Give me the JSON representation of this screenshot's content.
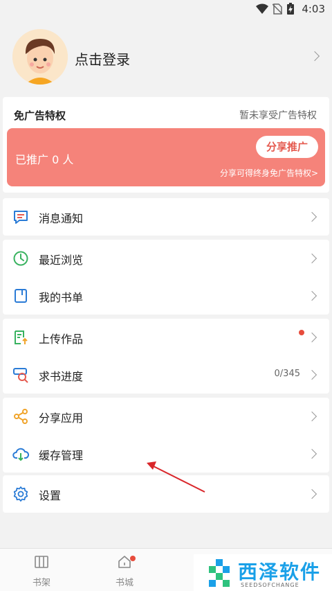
{
  "status": {
    "time": "4:03"
  },
  "profile": {
    "login_label": "点击登录"
  },
  "ad_privilege": {
    "title": "免广告特权",
    "status": "暂未享受广告特权",
    "promoted_text": "已推广 0 人",
    "share_button": "分享推广",
    "share_hint": "分享可得终身免广告特权>"
  },
  "menu": {
    "messages": "消息通知",
    "recent": "最近浏览",
    "booklist": "我的书单",
    "upload": "上传作品",
    "request_progress": "求书进度",
    "request_count": "0/345",
    "share_app": "分享应用",
    "cache": "缓存管理",
    "settings": "设置"
  },
  "tabs": {
    "bookshelf": "书架",
    "bookstore": "书城"
  },
  "watermark": {
    "text": "西泽软件",
    "sub": "SEEDSOFCHANGE"
  },
  "colors": {
    "accent_red": "#f5837a",
    "icon_blue": "#2a7bd6",
    "icon_green": "#38b25f",
    "icon_orange": "#f0a42a"
  }
}
